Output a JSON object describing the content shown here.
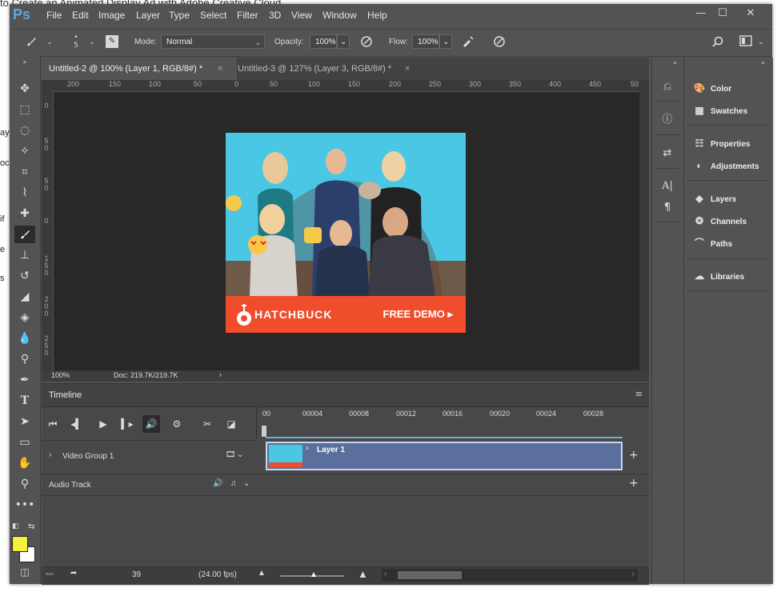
{
  "background": {
    "heading_fragment": "to Create an Animated Display Ad with Adobe Creative Cloud",
    "left_fragments": [
      "ay",
      "oc",
      "if",
      "e",
      "s"
    ]
  },
  "app": {
    "logo": "Ps",
    "menu": [
      "File",
      "Edit",
      "Image",
      "Layer",
      "Type",
      "Select",
      "Filter",
      "3D",
      "View",
      "Window",
      "Help"
    ],
    "window_controls": {
      "minimize": "—",
      "restore": "☐",
      "close": "✕"
    }
  },
  "options_bar": {
    "brush_size": "5",
    "mode_label": "Mode:",
    "mode_value": "Normal",
    "opacity_label": "Opacity:",
    "opacity_value": "100%",
    "flow_label": "Flow:",
    "flow_value": "100%"
  },
  "tabs": [
    {
      "label": "Untitled-2 @ 100% (Layer 1, RGB/8#) *",
      "active": true
    },
    {
      "label": "Untitled-3 @ 127% (Layer 3, RGB/8#) *",
      "active": false
    }
  ],
  "rulers": {
    "top": [
      "200",
      "150",
      "100",
      "50",
      "0",
      "50",
      "100",
      "150",
      "200",
      "250",
      "300",
      "350",
      "400",
      "450",
      "50"
    ],
    "left": [
      "0",
      "5 0",
      "5 0",
      "0",
      "1 5 0",
      "2 0 0",
      "2 5 0"
    ]
  },
  "status": {
    "zoom": "100%",
    "doc": "Doc: 219.7K/219.7K"
  },
  "artwork": {
    "brand": "HATCHBUCK",
    "cta": "FREE DEMO"
  },
  "timeline": {
    "title": "Timeline",
    "ruler": [
      "00",
      "00004",
      "00008",
      "00012",
      "00016",
      "00020",
      "00024",
      "00028"
    ],
    "tracks": [
      {
        "label": "Video Group 1"
      },
      {
        "label": "Audio Track"
      }
    ],
    "clip_label": "Layer 1",
    "frame": "39",
    "fps": "(24.00 fps)"
  },
  "panels": [
    {
      "label": "Color",
      "icon": "color-icon"
    },
    {
      "label": "Swatches",
      "icon": "swatches-icon"
    },
    {
      "label": "Properties",
      "icon": "properties-icon"
    },
    {
      "label": "Adjustments",
      "icon": "adjustments-icon"
    },
    {
      "label": "Layers",
      "icon": "layers-icon"
    },
    {
      "label": "Channels",
      "icon": "channels-icon"
    },
    {
      "label": "Paths",
      "icon": "paths-icon"
    },
    {
      "label": "Libraries",
      "icon": "libraries-icon"
    }
  ],
  "colors": {
    "foreground": "#f5f03c",
    "background": "#ffffff",
    "art_bg": "#4bc7e6",
    "art_banner": "#f04d2d",
    "clip": "#5a6f9c"
  }
}
